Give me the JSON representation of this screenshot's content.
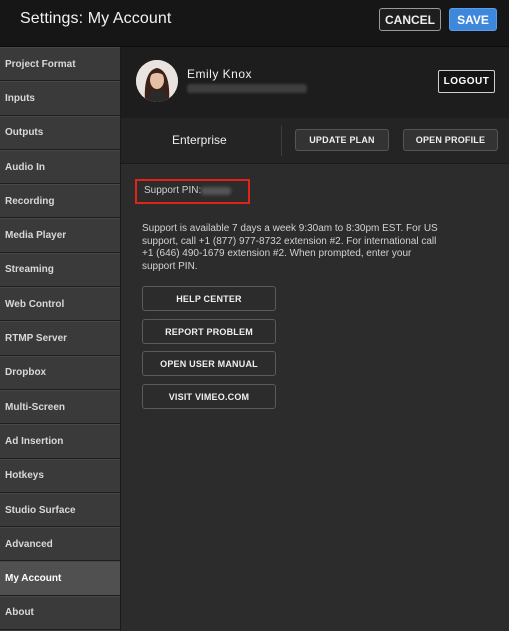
{
  "header": {
    "title": "Settings: My Account",
    "cancel_label": "CANCEL",
    "save_label": "SAVE"
  },
  "sidebar": {
    "items": [
      {
        "label": "Project Format",
        "active": false
      },
      {
        "label": "Inputs",
        "active": false
      },
      {
        "label": "Outputs",
        "active": false
      },
      {
        "label": "Audio In",
        "active": false
      },
      {
        "label": "Recording",
        "active": false
      },
      {
        "label": "Media Player",
        "active": false
      },
      {
        "label": "Streaming",
        "active": false
      },
      {
        "label": "Web Control",
        "active": false
      },
      {
        "label": "RTMP Server",
        "active": false
      },
      {
        "label": "Dropbox",
        "active": false
      },
      {
        "label": "Multi-Screen",
        "active": false
      },
      {
        "label": "Ad Insertion",
        "active": false
      },
      {
        "label": "Hotkeys",
        "active": false
      },
      {
        "label": "Studio Surface",
        "active": false
      },
      {
        "label": "Advanced",
        "active": false
      },
      {
        "label": "My Account",
        "active": true
      },
      {
        "label": "About",
        "active": false
      }
    ]
  },
  "account": {
    "name": "Emily Knox",
    "logout_label": "LOGOUT",
    "plan": "Enterprise",
    "update_plan_label": "UPDATE PLAN",
    "open_profile_label": "OPEN PROFILE"
  },
  "support": {
    "pin_label": "Support PIN:",
    "text": "Support is available 7 days a week 9:30am to 8:30pm EST. For US support, call +1 (877) 977-8732 extension #2. For international call +1 (646) 490-1679 extension #2. When prompted, enter your support PIN.",
    "buttons": [
      "HELP CENTER",
      "REPORT PROBLEM",
      "OPEN USER MANUAL",
      "VISIT VIMEO.COM"
    ]
  },
  "colors": {
    "accent": "#3d87dc",
    "highlight": "#e02418"
  }
}
